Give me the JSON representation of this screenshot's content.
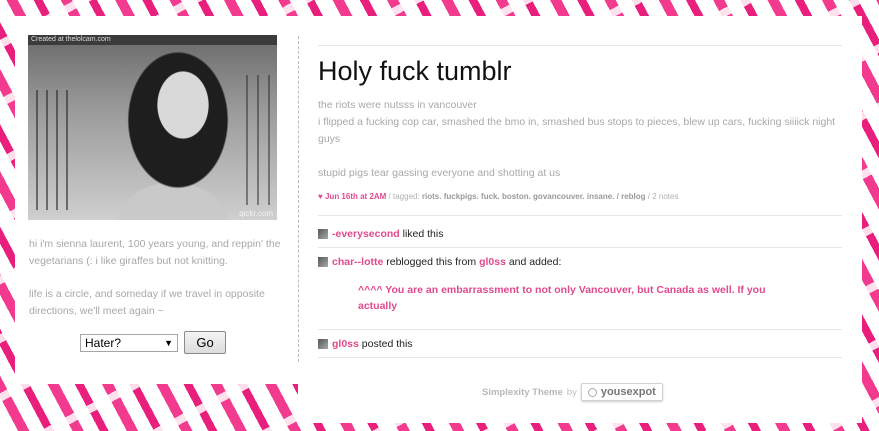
{
  "sidebar": {
    "photo_caption": "Created at thelolcam.com",
    "photo_watermark": "qickr.com",
    "bio_1": "hi i'm sienna laurent, 100 years young, and reppin' the vegetarians (: i like giraffes but not knitting.",
    "bio_2": "life is a circle, and someday if we travel in opposite directions, we'll meet again ~",
    "hater_select": "Hater?",
    "go_button": "Go"
  },
  "post": {
    "title": "Holy fuck tumblr",
    "body_1": "the riots were nutsss in vancouver",
    "body_2": "i flipped a fucking cop car, smashed the bmo in, smashed bus stops to pieces, blew up cars, fucking siiiick night guys",
    "body_3": "stupid pigs tear gassing everyone and shotting at us",
    "date": "Jun 16th at 2AM",
    "tagged_label": " / tagged: ",
    "tags": "riots. fuckpigs. fuck. boston. govancouver. insane.",
    "reblog_label": " / reblog",
    "notes_count": " / 2 notes"
  },
  "notes": [
    {
      "user": "-everysecond",
      "text": " liked this"
    },
    {
      "user": "char--lotte",
      "text": " reblogged this from ",
      "source": "gl0ss",
      "text2": " and added:"
    },
    {
      "user": "gl0ss",
      "text": " posted this"
    }
  ],
  "quote": "^^^^ You are an embarrassment to not only Vancouver, but Canada as well. If you actually",
  "footer": {
    "theme": "Simplexity Theme",
    "by": "by",
    "author": "yousexpot"
  },
  "colors": {
    "accent": "#e04a8f",
    "zebra_pink": "#f23a8e"
  }
}
